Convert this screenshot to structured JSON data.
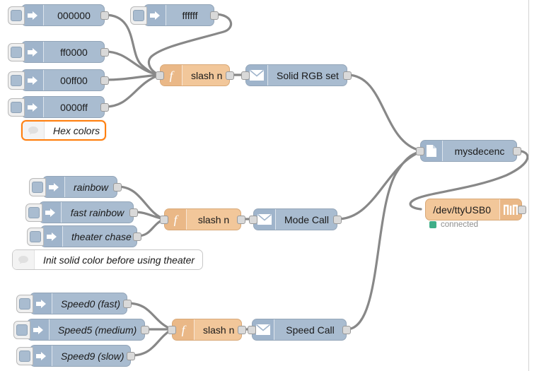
{
  "canvas": {
    "title": "Node-RED flow editor canvas",
    "background": "#ffffff",
    "wire_color": "#888888",
    "node_blue": "#a9bcd0",
    "node_orange": "#f2c79a",
    "selected_color": "#ff7f0e",
    "status_ok_color": "#3FAE88"
  },
  "nodes": {
    "inject_000000": {
      "label": "000000",
      "type": "inject",
      "icon": "inject-arrow-icon"
    },
    "inject_ffffff": {
      "label": "ffffff",
      "type": "inject",
      "icon": "inject-arrow-icon"
    },
    "inject_ff0000": {
      "label": "ff0000",
      "type": "inject",
      "icon": "inject-arrow-icon"
    },
    "inject_00ff00": {
      "label": "00ff00",
      "type": "inject",
      "icon": "inject-arrow-icon"
    },
    "inject_0000ff": {
      "label": "0000ff",
      "type": "inject",
      "icon": "inject-arrow-icon"
    },
    "inject_rainbow": {
      "label": "rainbow",
      "type": "inject",
      "icon": "inject-arrow-icon"
    },
    "inject_fast_rainbow": {
      "label": "fast rainbow",
      "type": "inject",
      "icon": "inject-arrow-icon"
    },
    "inject_theater_chase": {
      "label": "theater chase",
      "type": "inject",
      "icon": "inject-arrow-icon"
    },
    "inject_speed0": {
      "label": "Speed0 (fast)",
      "type": "inject",
      "icon": "inject-arrow-icon"
    },
    "inject_speed5": {
      "label": "Speed5 (medium)",
      "type": "inject",
      "icon": "inject-arrow-icon"
    },
    "inject_speed9": {
      "label": "Speed9 (slow)",
      "type": "inject",
      "icon": "inject-arrow-icon"
    },
    "fn_slash_n_1": {
      "label": "slash n",
      "type": "function",
      "icon": "function-f-icon"
    },
    "fn_slash_n_2": {
      "label": "slash n",
      "type": "function",
      "icon": "function-f-icon"
    },
    "fn_slash_n_3": {
      "label": "slash n",
      "type": "function",
      "icon": "function-f-icon"
    },
    "solid_rgb_set": {
      "label": "Solid RGB set",
      "type": "envelope",
      "icon": "envelope-icon"
    },
    "mode_call": {
      "label": "Mode Call",
      "type": "envelope",
      "icon": "envelope-icon"
    },
    "speed_call": {
      "label": "Speed Call",
      "type": "envelope",
      "icon": "envelope-icon"
    },
    "mysdecenc": {
      "label": "mysdecenc",
      "type": "file",
      "icon": "file-page-icon"
    },
    "serial_out": {
      "label": "/dev/ttyUSB0",
      "type": "serial",
      "icon": "square-wave-icon"
    },
    "comment_hex": {
      "label": "Hex colors",
      "type": "comment",
      "icon": "comment-bubble-icon",
      "selected": true
    },
    "comment_init": {
      "label": "Init solid color before using theater",
      "type": "comment",
      "icon": "comment-bubble-icon",
      "selected": false
    }
  },
  "status": {
    "serial": {
      "text": "connected",
      "color": "#3FAE88"
    }
  }
}
